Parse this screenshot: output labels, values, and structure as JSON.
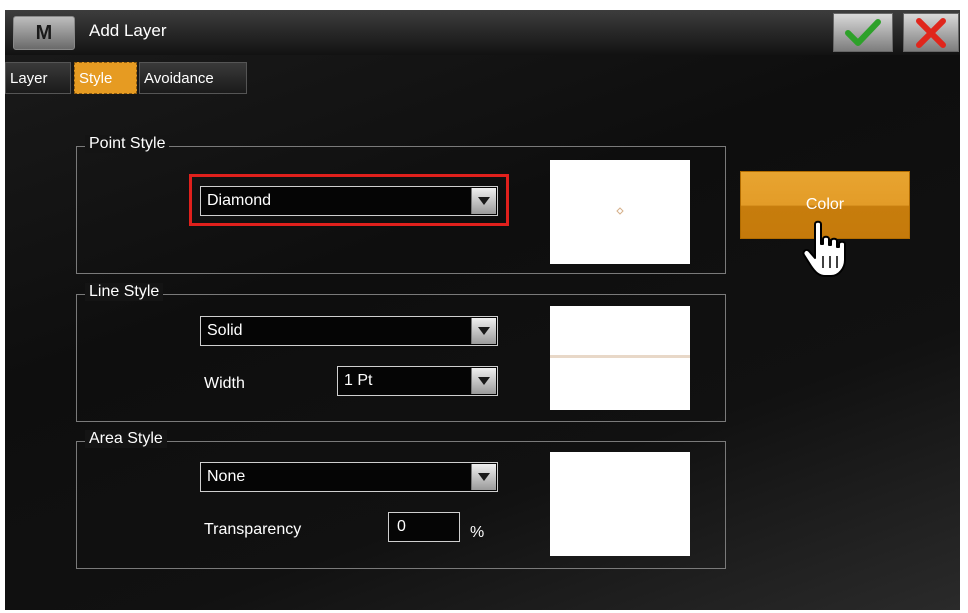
{
  "app": {
    "logo_text": "M",
    "title": "Add Layer"
  },
  "toolbar": {
    "ok_icon": "checkmark-icon",
    "cancel_icon": "close-x-icon"
  },
  "tabs": [
    {
      "label": "Layer",
      "active": false
    },
    {
      "label": "Style",
      "active": true
    },
    {
      "label": "Avoidance",
      "active": false
    }
  ],
  "point_style": {
    "legend": "Point Style",
    "selected": "Diamond"
  },
  "line_style": {
    "legend": "Line Style",
    "selected": "Solid",
    "width_label": "Width",
    "width_value": "1 Pt"
  },
  "area_style": {
    "legend": "Area Style",
    "selected": "None",
    "transparency_label": "Transparency",
    "transparency_value": "0",
    "transparency_unit": "%"
  },
  "color_button": {
    "label": "Color"
  },
  "colors": {
    "accent": "#e69b22",
    "highlight": "#e0201c",
    "preview_line": "#e8d8c8"
  }
}
